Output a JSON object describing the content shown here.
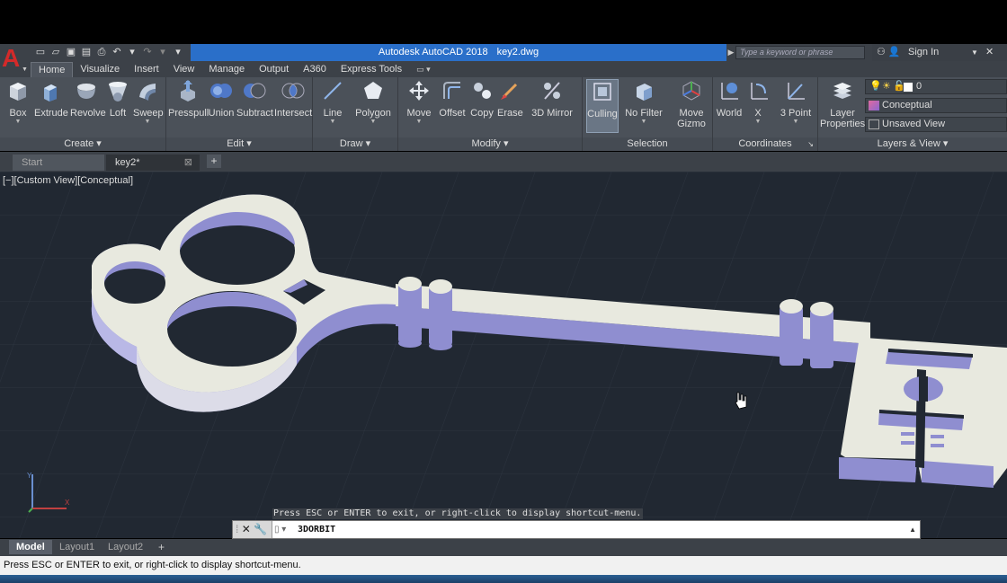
{
  "title": {
    "app": "Autodesk AutoCAD 2018",
    "file": "key2.dwg",
    "search_placeholder": "Type a keyword or phrase",
    "sign_in": "Sign In"
  },
  "ribbon_tabs": [
    "Home",
    "Visualize",
    "Insert",
    "View",
    "Manage",
    "Output",
    "A360",
    "Express Tools"
  ],
  "panels": {
    "create": {
      "title": "Create",
      "tools": [
        "Box",
        "Extrude",
        "Revolve",
        "Loft",
        "Sweep"
      ]
    },
    "edit": {
      "title": "Edit",
      "tools": [
        "Presspull",
        "Union",
        "Subtract",
        "Intersect"
      ]
    },
    "draw": {
      "title": "Draw",
      "tools": [
        "Line",
        "Polygon"
      ]
    },
    "modify": {
      "title": "Modify",
      "tools": [
        "Move",
        "Offset",
        "Copy",
        "Erase",
        "3D Mirror"
      ]
    },
    "selection": {
      "title": "Selection",
      "tools": [
        "Culling",
        "No Filter",
        "Move",
        "Gizmo"
      ]
    },
    "coordinates": {
      "title": "Coordinates",
      "tools": [
        "World",
        "X",
        "3 Point"
      ]
    },
    "layers": {
      "title": "Layers & View",
      "layer_properties": [
        "Layer",
        "Properties"
      ],
      "current_layer": "0",
      "visual_style": "Conceptual",
      "named_view": "Unsaved View"
    }
  },
  "doc_tabs": {
    "start": "Start",
    "current": "key2*"
  },
  "viewport": {
    "label": "[−][Custom View][Conceptual]"
  },
  "command": {
    "history": "Press ESC or ENTER to exit, or right-click to display shortcut-menu.",
    "current": "3DORBIT"
  },
  "layout_tabs": [
    "Model",
    "Layout1",
    "Layout2"
  ],
  "status_text": "Press ESC or ENTER to exit, or right-click to display shortcut-menu.",
  "colors": {
    "viewport_bg": "#212832",
    "key_face": "#e8e9df",
    "key_side": "#8f8ed0",
    "title_accent": "#2a6fc9"
  }
}
